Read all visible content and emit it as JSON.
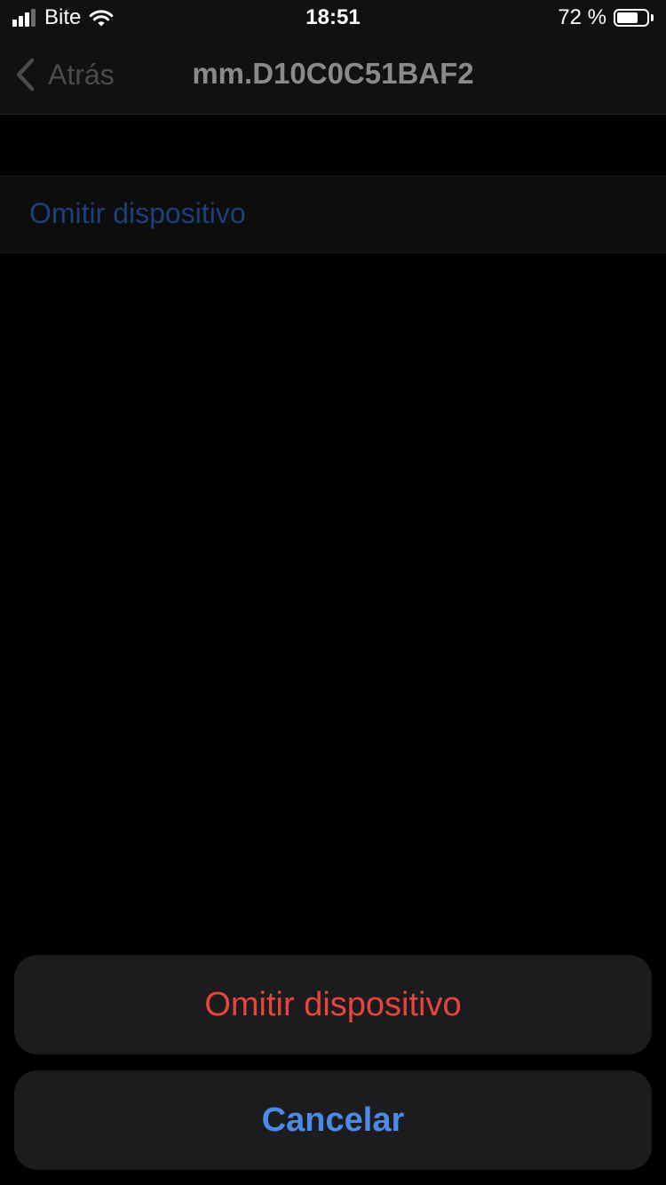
{
  "status_bar": {
    "carrier": "Bite",
    "time": "18:51",
    "battery_text": "72 %",
    "battery_level": 0.72,
    "signal_bars_active": 3,
    "signal_bars_total": 4,
    "icons": [
      "cell-signal-icon",
      "wifi-icon",
      "battery-icon"
    ]
  },
  "nav_bar": {
    "back_label": "Atrás",
    "title": "mm.D10C0C51BAF2",
    "icons": [
      "chevron-left-icon"
    ]
  },
  "content": {
    "omit_cell_label": "Omitir dispositivo"
  },
  "action_sheet": {
    "omit_label": "Omitir dispositivo",
    "cancel_label": "Cancelar"
  },
  "colors": {
    "background": "#000000",
    "destructive": "#e4463b",
    "accent": "#4c8ae8",
    "dimmed_link": "#1d3f7a",
    "sheet_button": "#1c1c1e"
  }
}
